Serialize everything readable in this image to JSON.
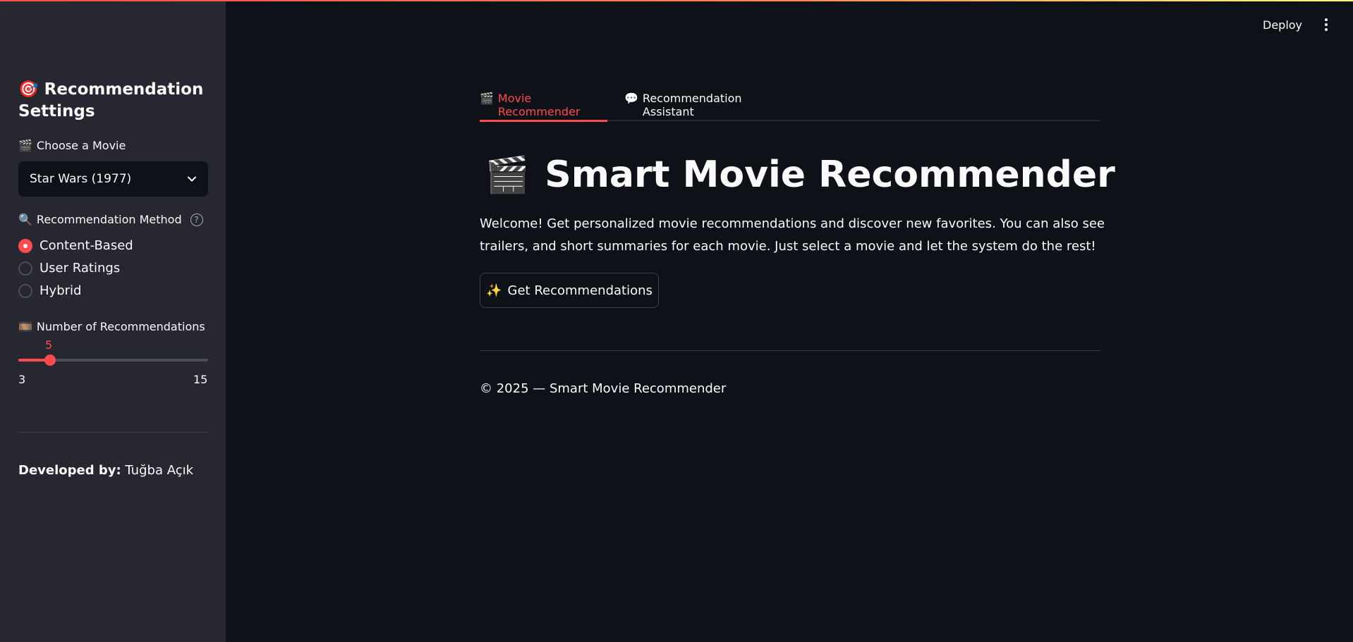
{
  "header": {
    "deploy_label": "Deploy",
    "menu_icon": "kebab-menu-icon"
  },
  "sidebar": {
    "title_icon": "🎯",
    "title": "Recommendation Settings",
    "movie_label_icon": "🎬",
    "movie_label": "Choose a Movie",
    "movie_selected": "Star Wars (1977)",
    "method_label_icon": "🔍",
    "method_label": "Recommendation Method",
    "methods": [
      "Content-Based",
      "User Ratings",
      "Hybrid"
    ],
    "method_selected": "Content-Based",
    "count_label_icon": "🎞️",
    "count_label": "Number of Recommendations",
    "slider": {
      "value": 5,
      "min": 3,
      "max": 15
    },
    "dev_prefix": "Developed by:",
    "dev_name": "Tuğba Açık"
  },
  "tabs": [
    {
      "icon": "🎬",
      "label": "Movie Recommender",
      "active": true
    },
    {
      "icon": "💬",
      "label": "Recommendation Assistant",
      "active": false
    }
  ],
  "main": {
    "title_icon": "🎬",
    "title": "Smart Movie Recommender",
    "welcome": "Welcome! Get personalized movie recommendations and discover new favorites. You can also see trailers, and short summaries for each movie. Just select a movie and let the system do the rest!",
    "button_icon": "✨",
    "button_label": "Get Recommendations",
    "footer": "© 2025 — Smart Movie Recommender"
  },
  "colors": {
    "accent": "#ff4b4b",
    "background": "#0e1117",
    "sidebar": "#262730"
  }
}
